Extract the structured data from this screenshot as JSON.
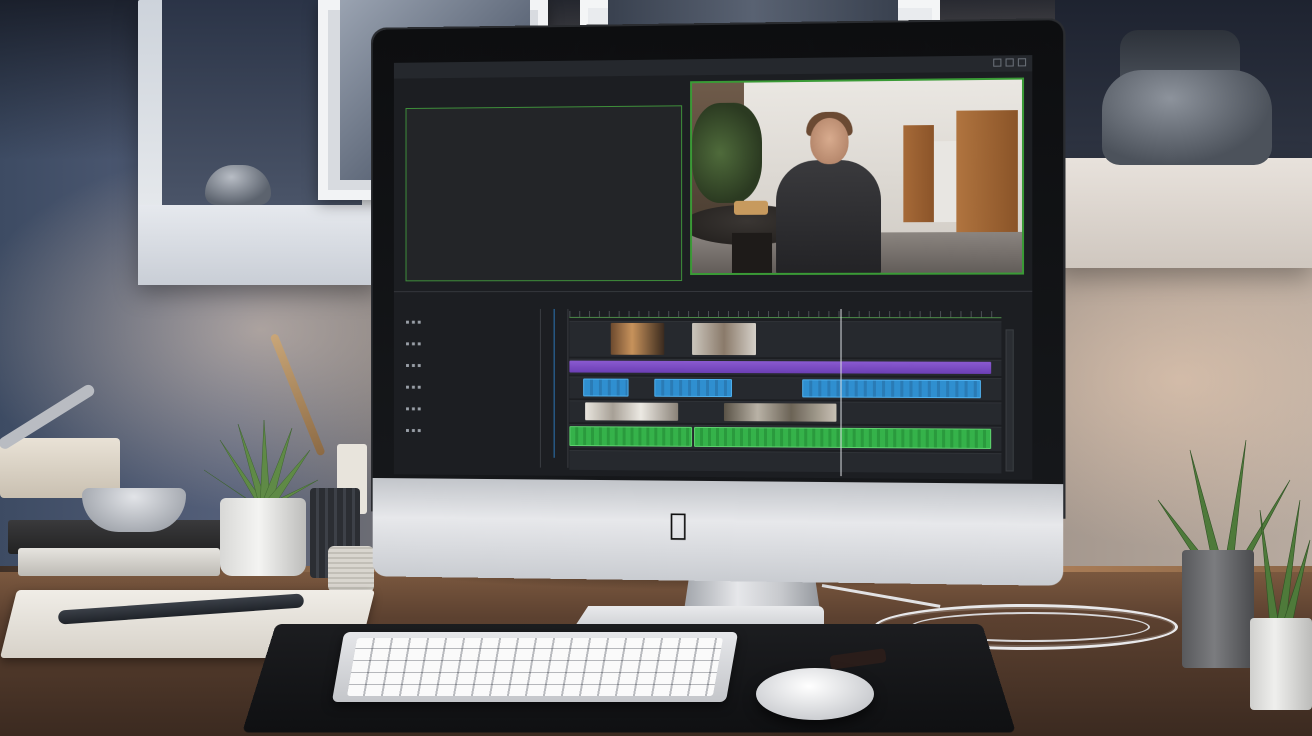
{
  "scene": {
    "kind": "photo of a desktop computer on a desk showing a video editing application",
    "apple_logo_glyph": ""
  },
  "screen": {
    "menubar_items": [
      "",
      "",
      "",
      "",
      ""
    ],
    "panel_header_labels": [
      "",
      "",
      "",
      "",
      "",
      "",
      "",
      "",
      "",
      "",
      ""
    ],
    "source_viewer_caption": "",
    "program_viewer_caption": ""
  },
  "colors": {
    "accent_green": "#3a9a36",
    "clip_blue": "#2f8fd0",
    "clip_green": "#35b24a",
    "clip_purple": "#7a4bc4",
    "playhead": "#d7dadf"
  }
}
